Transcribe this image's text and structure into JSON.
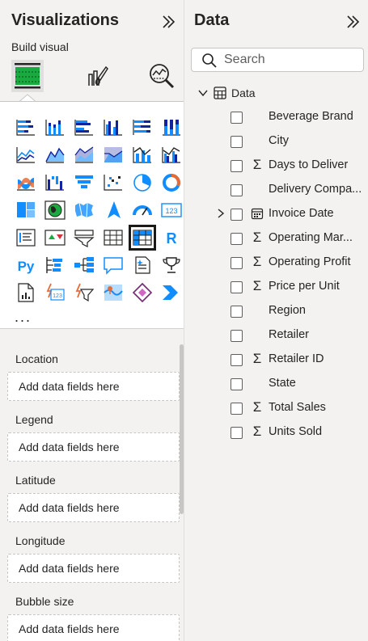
{
  "visualizations": {
    "title": "Visualizations",
    "build_label": "Build visual",
    "more": "...",
    "icons": [
      "stacked-bar-chart-icon",
      "stacked-column-chart-icon",
      "clustered-bar-chart-icon",
      "clustered-column-chart-icon",
      "100-percent-stacked-bar-chart-icon",
      "100-percent-stacked-column-chart-icon",
      "line-chart-icon",
      "area-chart-icon",
      "stacked-area-chart-icon",
      "100-percent-stacked-area-chart-icon",
      "line-and-stacked-column-chart-icon",
      "line-and-clustered-column-chart-icon",
      "ribbon-chart-icon",
      "waterfall-chart-icon",
      "funnel-chart-icon",
      "scatter-chart-icon",
      "pie-chart-icon",
      "donut-chart-icon",
      "treemap-icon",
      "map-icon",
      "filled-map-icon",
      "azure-map-icon",
      "gauge-icon",
      "card-icon",
      "multi-row-card-icon",
      "kpi-icon",
      "slicer-icon",
      "table-icon",
      "matrix-icon",
      "r-script-visual-icon",
      "python-visual-icon",
      "key-influencers-icon",
      "decomposition-tree-icon",
      "qna-icon",
      "smart-narrative-icon",
      "metrics-icon",
      "paginated-report-icon",
      "power-apps-icon",
      "power-automate-icon",
      "arcgis-map-icon",
      "power-apps-alt-icon",
      "chevron-visual-icon"
    ],
    "selected_icon": "matrix-icon",
    "wells": [
      {
        "label": "Location",
        "placeholder": "Add data fields here"
      },
      {
        "label": "Legend",
        "placeholder": "Add data fields here"
      },
      {
        "label": "Latitude",
        "placeholder": "Add data fields here"
      },
      {
        "label": "Longitude",
        "placeholder": "Add data fields here"
      },
      {
        "label": "Bubble size",
        "placeholder": "Add data fields here"
      }
    ]
  },
  "data_pane": {
    "title": "Data",
    "search_placeholder": "Search",
    "table_name": "Data",
    "fields": [
      {
        "label": "Beverage Brand",
        "type": "text"
      },
      {
        "label": "City",
        "type": "text"
      },
      {
        "label": "Days to Deliver",
        "type": "sum"
      },
      {
        "label": "Delivery Compa...",
        "type": "text"
      },
      {
        "label": "Invoice Date",
        "type": "date"
      },
      {
        "label": "Operating Mar...",
        "type": "sum"
      },
      {
        "label": "Operating Profit",
        "type": "sum"
      },
      {
        "label": "Price per Unit",
        "type": "sum"
      },
      {
        "label": "Region",
        "type": "text"
      },
      {
        "label": "Retailer",
        "type": "text"
      },
      {
        "label": "Retailer ID",
        "type": "sum"
      },
      {
        "label": "State",
        "type": "text"
      },
      {
        "label": "Total Sales",
        "type": "sum"
      },
      {
        "label": "Units Sold",
        "type": "sum"
      }
    ]
  },
  "colors": {
    "accent_blue": "#118dff",
    "accent_teal": "#1aab40",
    "pane_bg": "#f3f2f1",
    "text": "#252423"
  }
}
